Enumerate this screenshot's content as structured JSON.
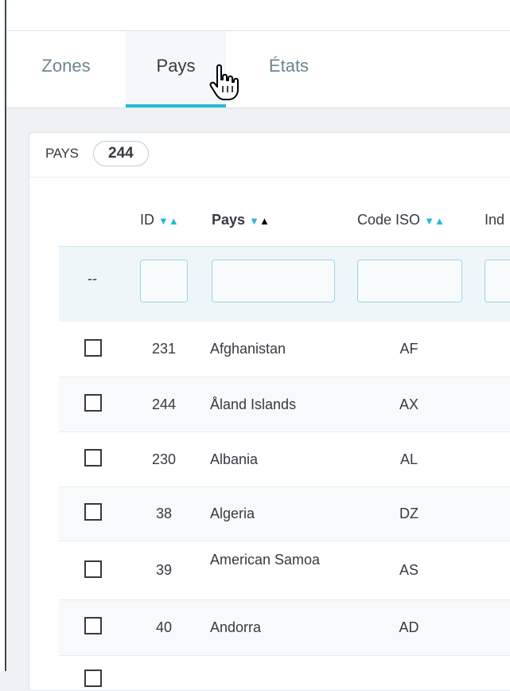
{
  "tabs": [
    {
      "label": "Zones",
      "active": false
    },
    {
      "label": "Pays",
      "active": true
    },
    {
      "label": "États",
      "active": false
    }
  ],
  "card": {
    "title": "PAYS",
    "count": "244"
  },
  "table": {
    "columns": [
      "ID",
      "Pays",
      "Code ISO",
      "Ind"
    ],
    "filter_dash": "--",
    "rows": [
      {
        "id": "231",
        "name": "Afghanistan",
        "iso": "AF"
      },
      {
        "id": "244",
        "name": "Åland Islands",
        "iso": "AX"
      },
      {
        "id": "230",
        "name": "Albania",
        "iso": "AL"
      },
      {
        "id": "38",
        "name": "Algeria",
        "iso": "DZ"
      },
      {
        "id": "39",
        "name": "American Samoa",
        "iso": "AS"
      },
      {
        "id": "40",
        "name": "Andorra",
        "iso": "AD"
      }
    ]
  },
  "colors": {
    "accent": "#25b9d7",
    "text": "#363a41",
    "muted": "#6c868e"
  }
}
